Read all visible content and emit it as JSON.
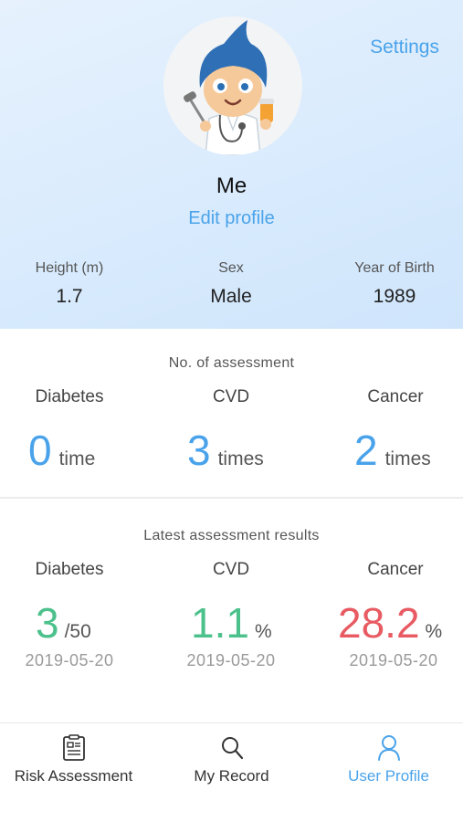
{
  "header": {
    "settings_label": "Settings",
    "user_name": "Me",
    "edit_profile_label": "Edit profile",
    "info": [
      {
        "label": "Height (m)",
        "value": "1.7"
      },
      {
        "label": "Sex",
        "value": "Male"
      },
      {
        "label": "Year of Birth",
        "value": "1989"
      }
    ]
  },
  "assessment_count": {
    "title": "No. of assessment",
    "items": [
      {
        "label": "Diabetes",
        "count": "0",
        "unit": "time"
      },
      {
        "label": "CVD",
        "count": "3",
        "unit": "times"
      },
      {
        "label": "Cancer",
        "count": "2",
        "unit": "times"
      }
    ]
  },
  "latest_results": {
    "title": "Latest assessment results",
    "items": [
      {
        "label": "Diabetes",
        "value": "3",
        "unit": "/50",
        "date": "2019-05-20",
        "status_color": "#4cc18c"
      },
      {
        "label": "CVD",
        "value": "1.1",
        "unit": "%",
        "date": "2019-05-20",
        "status_color": "#4cc18c"
      },
      {
        "label": "Cancer",
        "value": "28.2",
        "unit": "%",
        "date": "2019-05-20",
        "status_color": "#e85b63"
      }
    ]
  },
  "tabbar": {
    "tabs": [
      {
        "label": "Risk Assessment",
        "icon": "clipboard-icon"
      },
      {
        "label": "My Record",
        "icon": "search-icon"
      },
      {
        "label": "User Profile",
        "icon": "user-icon",
        "active": true
      }
    ]
  },
  "colors": {
    "accent": "#4aa3ea",
    "good": "#4cc18c",
    "bad": "#e85b63"
  }
}
